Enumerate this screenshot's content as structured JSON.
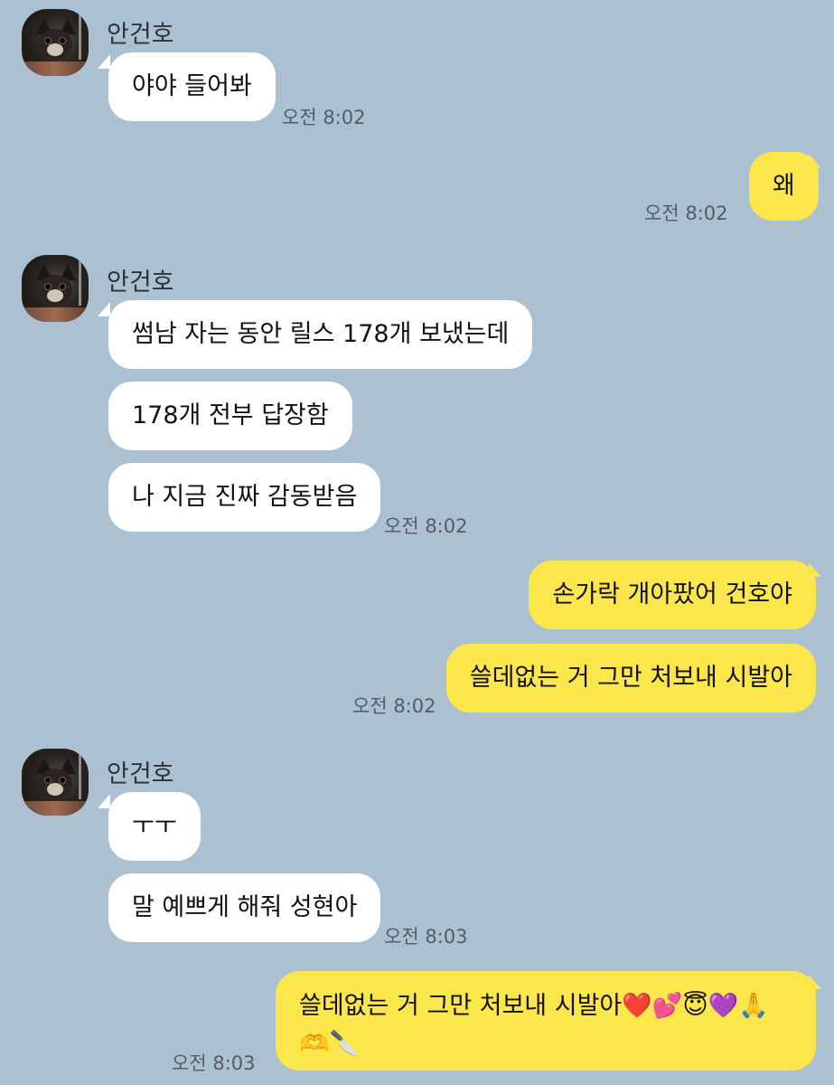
{
  "sender": {
    "name": "안건호"
  },
  "messages": {
    "m1": "야야 들어봐",
    "t1": "오전 8:02",
    "m2": "왜",
    "t2": "오전 8:02",
    "m3": "썸남 자는 동안 릴스 178개 보냈는데",
    "m4": "178개 전부 답장함",
    "m5": "나 지금 진짜 감동받음",
    "t3": "오전 8:02",
    "m6": "손가락 개아팠어 건호야",
    "m7": "쓸데없는 거 그만 처보내 시발아",
    "t4": "오전 8:02",
    "m8": "ㅜㅜ",
    "m9": "말 예쁘게 해줘 성현아",
    "t5": "오전 8:03",
    "m10_line1": "쓸데없는 거 그만 처보내 시발아❤️💕😇💜🙏",
    "m10_line2": "🫶🔪",
    "t6": "오전 8:03"
  },
  "colors": {
    "background": "#abc1d1",
    "incoming_bubble": "#ffffff",
    "outgoing_bubble": "#fbe64b"
  }
}
